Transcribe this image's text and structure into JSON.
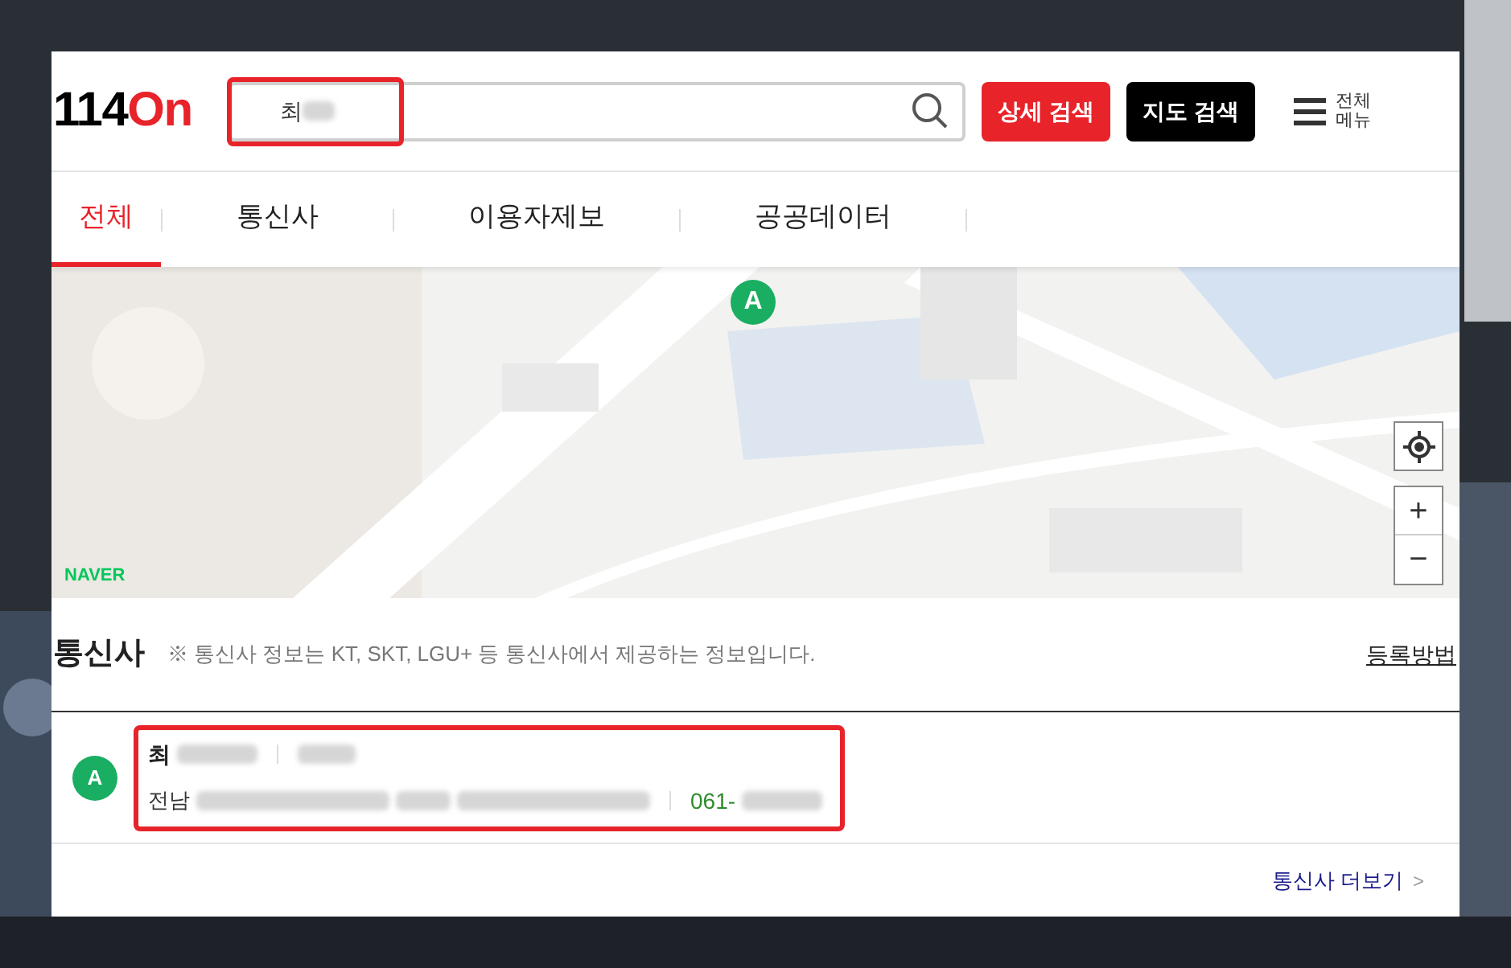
{
  "logo": {
    "digits": "114",
    "suffix": "On"
  },
  "search": {
    "value": "최"
  },
  "buttons": [
    {
      "label": "상세 검색",
      "kind": "primary"
    },
    {
      "label": "지도 검색",
      "kind": "dark"
    }
  ],
  "menu": {
    "line1": "전체",
    "line2": "메뉴"
  },
  "tabs": [
    {
      "label": "전체",
      "selected": true
    },
    {
      "label": "통신사",
      "selected": false
    },
    {
      "label": "이용자제보",
      "selected": false
    },
    {
      "label": "공공데이터",
      "selected": false
    }
  ],
  "map": {
    "marker": "A",
    "brand": "NAVER",
    "zoom_in": "+",
    "zoom_out": "−"
  },
  "section": {
    "title": "통신사",
    "note": "※ 통신사 정보는 KT, SKT, LGU+ 등 통신사에서 제공하는 정보입니다.",
    "link": "등록방법"
  },
  "results": [
    {
      "marker": "A",
      "name": "최",
      "address": "전남",
      "phone": "061-"
    }
  ],
  "more": {
    "label": "통신사 더보기",
    "chevron": ">"
  }
}
